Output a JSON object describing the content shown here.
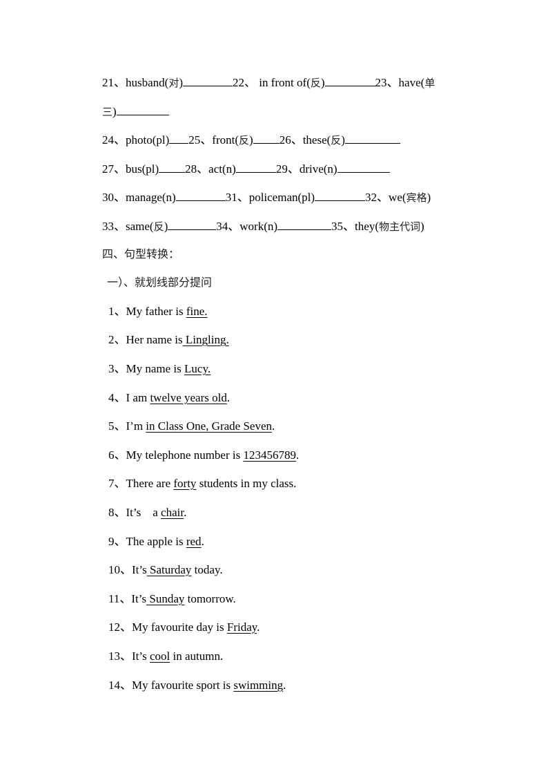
{
  "vocab": {
    "row1": [
      {
        "num": "21、",
        "word": "husband(",
        "hint": "对",
        "close": ")"
      },
      {
        "num": "22、",
        "word": " in front of(",
        "hint": "反",
        "close": ")"
      },
      {
        "num": "23、",
        "word": "have(",
        "hint": "单",
        "close": ""
      }
    ],
    "row1_cont": {
      "hint": "三",
      "close": ")"
    },
    "row2": [
      {
        "num": "24、",
        "word": "photo(pl)"
      },
      {
        "num": "25、",
        "word": "front(",
        "hint": "反",
        "close": ")"
      },
      {
        "num": "26、",
        "word": "these(",
        "hint": "反",
        "close": ")"
      }
    ],
    "row3": [
      {
        "num": "27、",
        "word": "bus(pl)"
      },
      {
        "num": "28、",
        "word": "act(n)"
      },
      {
        "num": "29、",
        "word": "drive(n)"
      }
    ],
    "row4": [
      {
        "num": "30、",
        "word": "manage(n)"
      },
      {
        "num": "31、",
        "word": "policeman(pl)"
      },
      {
        "num": "32、",
        "word": "we(",
        "hint": "宾格",
        "close": ")"
      }
    ],
    "row5": [
      {
        "num": "33、",
        "word": "same(",
        "hint": "反",
        "close": ")"
      },
      {
        "num": "34、",
        "word": "work(n)"
      },
      {
        "num": "35、",
        "word": "they(",
        "hint": "物主代词",
        "close": ")"
      }
    ]
  },
  "section": {
    "title": "四、句型转换：",
    "subtitle": "一）、就划线部分提问"
  },
  "questions": [
    {
      "num": "1、",
      "pre": "My father is ",
      "under": "fine.",
      "post": ""
    },
    {
      "num": "2、",
      "pre": "Her name is",
      "under": " Lingling.",
      "post": ""
    },
    {
      "num": "3、",
      "pre": "My name is ",
      "under": "Lucy.",
      "post": ""
    },
    {
      "num": "4、",
      "pre": "I am ",
      "under": "twelve years old",
      "post": "."
    },
    {
      "num": "5、",
      "pre": "I’m ",
      "under": "in Class One, Grade Seven",
      "post": "."
    },
    {
      "num": "6、",
      "pre": "My telephone number is ",
      "under": "123456789",
      "post": "."
    },
    {
      "num": "7、",
      "pre": "There are ",
      "under": "forty",
      "post": " students in my class."
    },
    {
      "num": "8、",
      "pre": "It’s    a ",
      "under": "chair",
      "post": "."
    },
    {
      "num": "9、",
      "pre": "The apple is ",
      "under": "red",
      "post": "."
    },
    {
      "num": "10、",
      "pre": "It’s",
      "under": " Saturday",
      "post": " today."
    },
    {
      "num": "11、",
      "pre": "It’s",
      "under": " Sunday",
      "post": " tomorrow."
    },
    {
      "num": "12、",
      "pre": "My favourite day is ",
      "under": "Friday",
      "post": "."
    },
    {
      "num": "13、",
      "pre": "It’s ",
      "under": "cool",
      "post": " in autumn."
    },
    {
      "num": "14、",
      "pre": "My favourite sport is ",
      "under": "swimming",
      "post": "."
    }
  ]
}
